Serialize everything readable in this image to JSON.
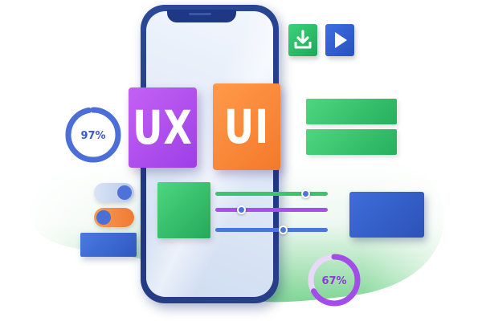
{
  "tiles": {
    "ux": "UX",
    "ui": "UI"
  },
  "gauges": [
    {
      "label": "97%",
      "value": 0.97,
      "color": "#4b6fd6"
    },
    {
      "label": "67%",
      "value": 0.67,
      "color": "#a24de8"
    }
  ],
  "sliders": [
    {
      "value": 0.8,
      "color": "#3cc46f"
    },
    {
      "value": 0.23,
      "color": "#a94ee8"
    },
    {
      "value": 0.6,
      "color": "#4b74dc"
    }
  ],
  "toggles": [
    {
      "state": "on"
    },
    {
      "state": "off"
    }
  ],
  "icons": {
    "download": "download-icon",
    "play": "play-icon"
  },
  "colors": {
    "purple": "#a24de8",
    "orange": "#f4792a",
    "green": "#2fbf65",
    "blue": "#3f6ddb"
  }
}
